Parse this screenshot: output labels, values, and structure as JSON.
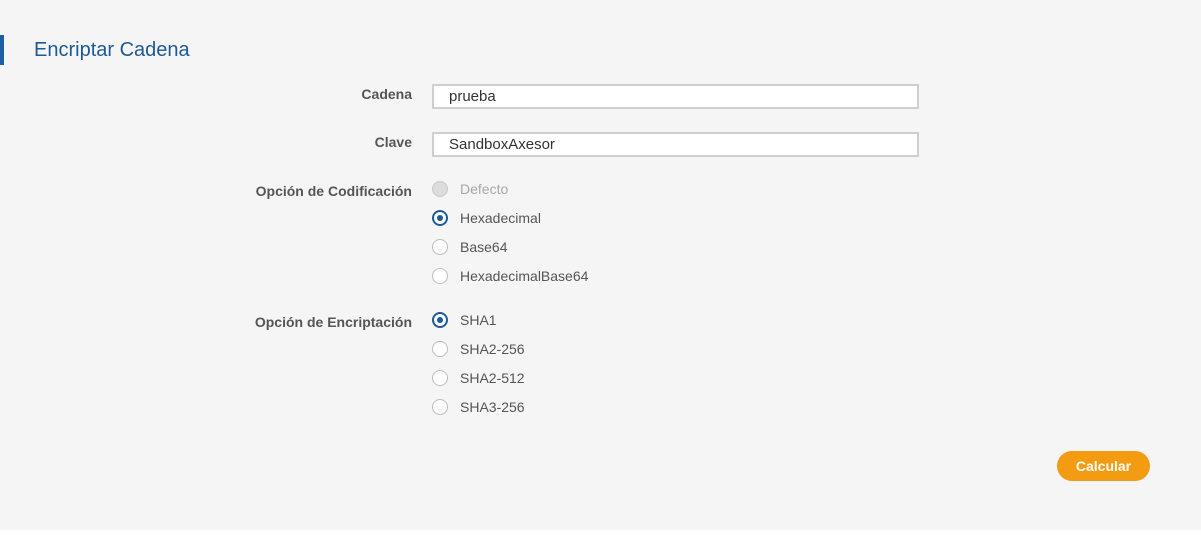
{
  "page": {
    "title": "Encriptar Cadena"
  },
  "form": {
    "cadena": {
      "label": "Cadena",
      "value": "prueba"
    },
    "clave": {
      "label": "Clave",
      "value": "SandboxAxesor"
    },
    "codificacion": {
      "label": "Opción de Codificación",
      "selected": "Hexadecimal",
      "options": [
        {
          "label": "Defecto",
          "checked": false,
          "disabled": true
        },
        {
          "label": "Hexadecimal",
          "checked": true,
          "disabled": false
        },
        {
          "label": "Base64",
          "checked": false,
          "disabled": false
        },
        {
          "label": "HexadecimalBase64",
          "checked": false,
          "disabled": false
        }
      ]
    },
    "encriptacion": {
      "label": "Opción de Encriptación",
      "selected": "SHA1",
      "options": [
        {
          "label": "SHA1",
          "checked": true,
          "disabled": false
        },
        {
          "label": "SHA2-256",
          "checked": false,
          "disabled": false
        },
        {
          "label": "SHA2-512",
          "checked": false,
          "disabled": false
        },
        {
          "label": "SHA3-256",
          "checked": false,
          "disabled": false
        }
      ]
    },
    "submit_label": "Calcular"
  },
  "colors": {
    "title": "#1e5a96",
    "accent_bar": "#1e5fa0",
    "radio_checked": "#1e5a96",
    "button": "#f39c12",
    "panel_background": "#f5f5f5"
  }
}
